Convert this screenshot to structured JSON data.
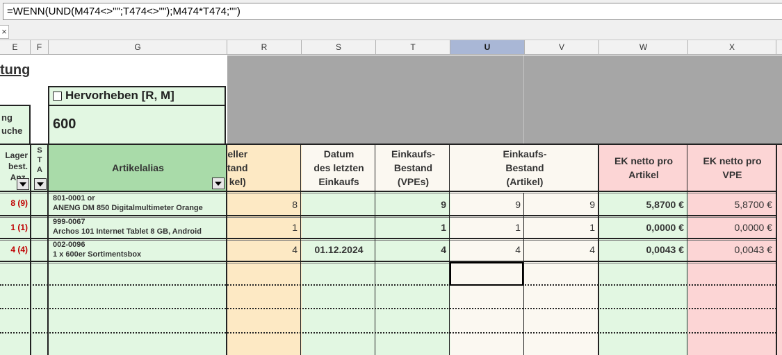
{
  "formula_bar": {
    "formula": "=WENN(UND(M474<>\"\";T474<>\"\");M474*T474;\"\")"
  },
  "tabbar": {
    "close_glyph": "×"
  },
  "columns": [
    "E",
    "F",
    "G",
    "R",
    "S",
    "T",
    "U",
    "V",
    "W",
    "X"
  ],
  "selected_column": "U",
  "sheet": {
    "title_fragment": "tung",
    "highlight_label": "Hervorheben [R, M]",
    "highlight_value": "600",
    "search_fragment_1": "ng",
    "search_fragment_2": "uche"
  },
  "headers": {
    "lager_1": "Lager",
    "lager_2": "best.",
    "lager_3": "Anz.",
    "sta_s": "S",
    "sta_t": "T",
    "sta_a": "A",
    "artikelalias": "Artikelalias",
    "r_1": "eller",
    "r_2": "tand",
    "r_3": "kel)",
    "s_1": "Datum",
    "s_2": "des letzten",
    "s_3": "Einkaufs",
    "t_1": "Einkaufs-",
    "t_2": "Bestand",
    "t_3": "(VPEs)",
    "uv_1": "Einkaufs-",
    "uv_2": "Bestand",
    "uv_3": "(Artikel)",
    "w_1": "EK netto pro",
    "w_2": "Artikel",
    "x_1": "EK netto pro",
    "x_2": "VPE"
  },
  "rows": [
    {
      "lager": "8 (9)",
      "id": "801-0001 or",
      "name": "ANENG DM 850 Digitalmultimeter Orange",
      "r": "8",
      "s": "",
      "t": "9",
      "u": "9",
      "v": "9",
      "w": "5,8700 €",
      "x": "5,8700 €"
    },
    {
      "lager": "1 (1)",
      "id": "999-0067",
      "name": "Archos 101 Internet Tablet 8 GB, Android",
      "r": "1",
      "s": "",
      "t": "1",
      "u": "1",
      "v": "1",
      "w": "0,0000 €",
      "x": "0,0000 €"
    },
    {
      "lager": "4 (4)",
      "id": "002-0096",
      "name": "1 x 600er Sortimentsbox",
      "r": "4",
      "s": "01.12.2024",
      "t": "4",
      "u": "4",
      "v": "4",
      "w": "0,0043 €",
      "x": "0,0043 €"
    }
  ],
  "colors": {
    "green": "#e2f7e2",
    "green_header": "#a9dba9",
    "orange": "#fde9c4",
    "pink": "#fcd5d5",
    "beige": "#fbf8f1",
    "gray": "#a6a6a6",
    "lager_red": "#c00000"
  }
}
